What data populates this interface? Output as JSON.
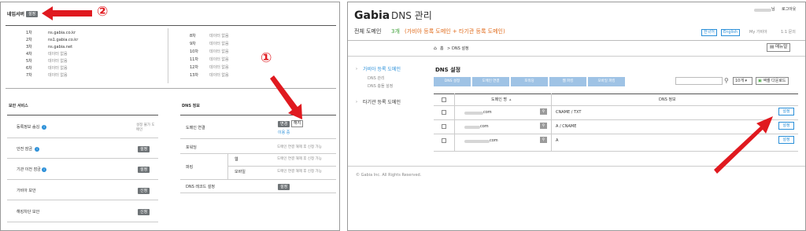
{
  "left": {
    "header": {
      "title": "네임서버",
      "set_button": "설정"
    },
    "annotation_1": "①",
    "annotation_2": "②",
    "nameservers": [
      {
        "label": "1차",
        "value": "ns.gabia.co.kr"
      },
      {
        "label": "2차",
        "value": "ns1.gabia.co.kr"
      },
      {
        "label": "3차",
        "value": "ns.gabia.net"
      },
      {
        "label": "4차",
        "value": "데이터 없음"
      },
      {
        "label": "5차",
        "value": "데이터 없음"
      },
      {
        "label": "6차",
        "value": "데이터 없음"
      },
      {
        "label": "7차",
        "value": "데이터 없음"
      }
    ],
    "nameservers_right": [
      {
        "label": "8차",
        "value": "데이터 없음"
      },
      {
        "label": "9차",
        "value": "데이터 없음"
      },
      {
        "label": "10차",
        "value": "데이터 없음"
      },
      {
        "label": "11차",
        "value": "데이터 없음"
      },
      {
        "label": "12차",
        "value": "데이터 없음"
      },
      {
        "label": "13차",
        "value": "데이터 없음"
      }
    ],
    "security": {
      "title": "보안 서비스",
      "rows": [
        {
          "label": "등록정보 숨김",
          "value": "설정 불가 도메인"
        },
        {
          "label": "안전 잠금",
          "button": "설정"
        },
        {
          "label": "기관 이전 잠금",
          "button": "설정"
        },
        {
          "label": "가비아 보안",
          "button": "신청"
        },
        {
          "label": "해킹차단 보안",
          "button": "신청"
        }
      ]
    },
    "dns_info": {
      "title": "DNS 정보",
      "domain_link_label": "도메인 연결",
      "change_button": "변경",
      "release_button": "해지",
      "in_use": "이용 중",
      "forwarding_label": "포워딩",
      "forwarding_value": "도메인 연결 해제 후 신청 가능",
      "parking_label": "파킹",
      "web_label": "웹",
      "web_value": "도메인 연결 해제 후 신청 가능",
      "mobile_label": "모바일",
      "mobile_value": "도메인 연결 해제 후 신청 가능",
      "dns_record_label": "DNS 레코드 설정",
      "dns_record_button": "설정"
    }
  },
  "right": {
    "brand": "Gabia",
    "title": "DNS 관리",
    "user_suffix": "님",
    "logout": "로그아웃",
    "total_domains_label": "전체 도메인",
    "total_count": "3개",
    "total_detail": "(가비아 등록 도메인 + 타기관 등록 도메인)",
    "lang_korean": "한국어",
    "lang_english": "English",
    "my_gabia": "My 가비아",
    "inquiry": "1:1 문의",
    "breadcrumb_home": "홈",
    "breadcrumb_sep": ">",
    "breadcrumb_current": "DNS 설정",
    "manual_button": "매뉴얼",
    "sidebar": [
      {
        "label": "가비아 등록 도메인",
        "active": true
      },
      {
        "label": "DNS 관리",
        "sub": true
      },
      {
        "label": "DNS 충돌 설정",
        "sub": true
      },
      {
        "label": "타기관 등록 도메인",
        "active": false
      }
    ],
    "content_title": "DNS 설정",
    "toolbar": [
      "DNS 설정",
      "도메인 연결",
      "포워딩",
      "웹 파킹",
      "모바일 파킹"
    ],
    "per_page": "10개",
    "excel_button": "엑셀 다운로드",
    "table": {
      "col_domain": "도메인 명",
      "col_dns": "DNS 정보",
      "rows": [
        {
          "domain": "com",
          "dns": "CNAME / TXT",
          "button": "설정"
        },
        {
          "domain": "com",
          "dns": "A / CNAME",
          "button": "설정"
        },
        {
          "domain": "com",
          "dns": "A",
          "button": "설정"
        }
      ]
    },
    "footer": "© Gabia Inc. All Rights Reserved."
  },
  "colors": {
    "arrow_red": "#e0191f",
    "accent_green": "#3da038",
    "accent_orange": "#e06a1a",
    "toolbar_blue": "#9fc3e5",
    "link_blue": "#2a8fd8"
  }
}
